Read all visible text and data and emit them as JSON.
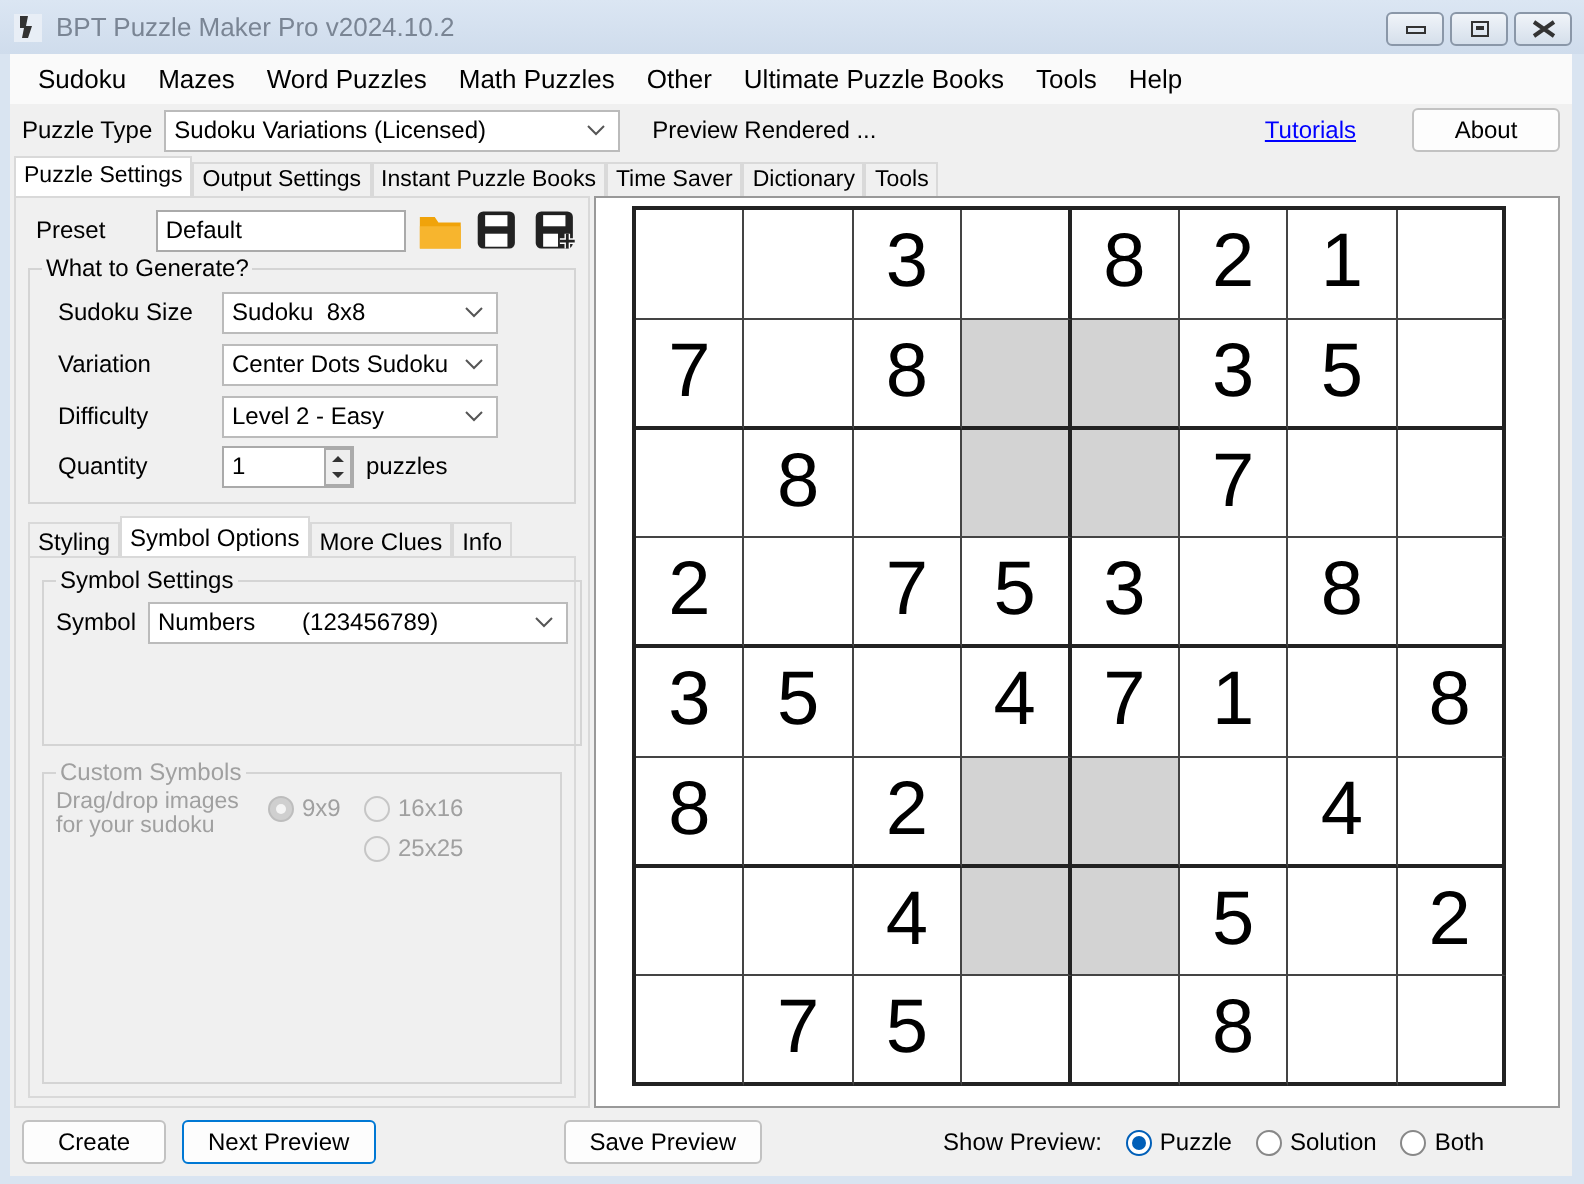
{
  "window": {
    "title": "BPT Puzzle Maker Pro v2024.10.2"
  },
  "menu": [
    "Sudoku",
    "Mazes",
    "Word Puzzles",
    "Math Puzzles",
    "Other",
    "Ultimate Puzzle Books",
    "Tools",
    "Help"
  ],
  "toolbar": {
    "puzzle_type_label": "Puzzle Type",
    "puzzle_type": "Sudoku Variations (Licensed)",
    "status": "Preview Rendered ...",
    "tutorials_link": "Tutorials",
    "about_button": "About"
  },
  "main_tabs": [
    {
      "label": "Puzzle Settings",
      "selected": true
    },
    {
      "label": "Output Settings",
      "selected": false
    },
    {
      "label": "Instant Puzzle Books",
      "selected": false
    },
    {
      "label": "Time Saver",
      "selected": false
    },
    {
      "label": "Dictionary",
      "selected": false
    },
    {
      "label": "Tools",
      "selected": false
    }
  ],
  "preset": {
    "label": "Preset",
    "value": "Default"
  },
  "generate": {
    "title": "What to Generate?",
    "fields": [
      {
        "label": "Sudoku Size",
        "value": "Sudoku  8x8"
      },
      {
        "label": "Variation",
        "value": "Center Dots Sudoku"
      },
      {
        "label": "Difficulty",
        "value": "Level 2 - Easy"
      }
    ],
    "quantity_label": "Quantity",
    "quantity": "1",
    "quantity_unit": "puzzles"
  },
  "sub_tabs": [
    {
      "label": "Styling",
      "selected": false
    },
    {
      "label": "Symbol Options",
      "selected": true
    },
    {
      "label": "More Clues",
      "selected": false
    },
    {
      "label": "Info",
      "selected": false
    }
  ],
  "symbol_settings": {
    "title": "Symbol Settings",
    "label": "Symbol",
    "value": "Numbers       (123456789)"
  },
  "custom_symbols": {
    "title": "Custom Symbols",
    "disabled": true,
    "hint": "Drag/drop images for your sudoku",
    "options": [
      {
        "label": "9x9",
        "selected": true
      },
      {
        "label": "16x16",
        "selected": false
      },
      {
        "label": "25x25",
        "selected": false
      }
    ]
  },
  "grid": [
    [
      {
        "shaded": false
      },
      {
        "shaded": false
      },
      {
        "value": "3",
        "shaded": false
      },
      {
        "shaded": false
      },
      {
        "value": "8",
        "shaded": false
      },
      {
        "value": "2",
        "shaded": false
      },
      {
        "value": "1",
        "shaded": false
      },
      {
        "shaded": false
      }
    ],
    [
      {
        "value": "7",
        "shaded": false
      },
      {
        "shaded": false
      },
      {
        "value": "8",
        "shaded": false
      },
      {
        "shaded": true
      },
      {
        "shaded": true
      },
      {
        "value": "3",
        "shaded": false
      },
      {
        "value": "5",
        "shaded": false
      },
      {
        "shaded": false
      }
    ],
    [
      {
        "shaded": false
      },
      {
        "value": "8",
        "shaded": false
      },
      {
        "shaded": false
      },
      {
        "shaded": true
      },
      {
        "shaded": true
      },
      {
        "value": "7",
        "shaded": false
      },
      {
        "shaded": false
      },
      {
        "shaded": false
      }
    ],
    [
      {
        "value": "2",
        "shaded": false
      },
      {
        "shaded": false
      },
      {
        "value": "7",
        "shaded": false
      },
      {
        "value": "5",
        "shaded": false
      },
      {
        "value": "3",
        "shaded": false
      },
      {
        "shaded": false
      },
      {
        "value": "8",
        "shaded": false
      },
      {
        "shaded": false
      }
    ],
    [
      {
        "value": "3",
        "shaded": false
      },
      {
        "value": "5",
        "shaded": false
      },
      {
        "shaded": false
      },
      {
        "value": "4",
        "shaded": false
      },
      {
        "value": "7",
        "shaded": false
      },
      {
        "value": "1",
        "shaded": false
      },
      {
        "shaded": false
      },
      {
        "value": "8",
        "shaded": false
      }
    ],
    [
      {
        "value": "8",
        "shaded": false
      },
      {
        "shaded": false
      },
      {
        "value": "2",
        "shaded": false
      },
      {
        "shaded": true
      },
      {
        "shaded": true
      },
      {
        "shaded": false
      },
      {
        "value": "4",
        "shaded": false
      },
      {
        "shaded": false
      }
    ],
    [
      {
        "shaded": false
      },
      {
        "shaded": false
      },
      {
        "value": "4",
        "shaded": false
      },
      {
        "shaded": true
      },
      {
        "shaded": true
      },
      {
        "value": "5",
        "shaded": false
      },
      {
        "shaded": false
      },
      {
        "value": "2",
        "shaded": false
      }
    ],
    [
      {
        "shaded": false
      },
      {
        "value": "7",
        "shaded": false
      },
      {
        "value": "5",
        "shaded": false
      },
      {
        "shaded": false
      },
      {
        "shaded": false
      },
      {
        "value": "8",
        "shaded": false
      },
      {
        "shaded": false
      },
      {
        "shaded": false
      }
    ]
  ],
  "bottom": {
    "buttons": [
      "Create",
      "Next Preview",
      "Save Preview"
    ],
    "show_preview_label": "Show Preview:",
    "show_preview": [
      {
        "label": "Puzzle",
        "selected": true
      },
      {
        "label": "Solution",
        "selected": false
      },
      {
        "label": "Both",
        "selected": false
      }
    ]
  }
}
